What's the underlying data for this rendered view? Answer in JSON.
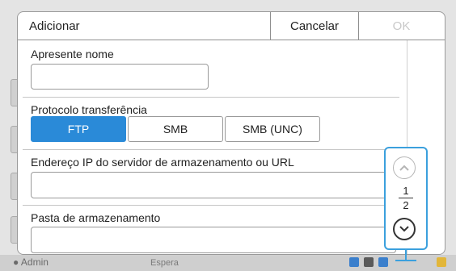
{
  "dialog": {
    "title": "Adicionar",
    "cancel_label": "Cancelar",
    "ok_label": "OK"
  },
  "fields": {
    "name_label": "Apresente nome",
    "name_value": "",
    "protocol_label": "Protocolo transferência",
    "protocol_options": [
      "FTP",
      "SMB",
      "SMB (UNC)"
    ],
    "protocol_selected": "FTP",
    "server_label": "Endereço IP do servidor de armazenamento ou URL",
    "server_value": "",
    "folder_label": "Pasta de armazenamento",
    "folder_value": ""
  },
  "pagination": {
    "current": "1",
    "total": "2"
  },
  "background": {
    "user_label": "Admin",
    "status_label": "Espera"
  },
  "colors": {
    "accent": "#2a8ad8",
    "callout": "#3ba0dd",
    "disabled_text": "#c8c8c8"
  }
}
